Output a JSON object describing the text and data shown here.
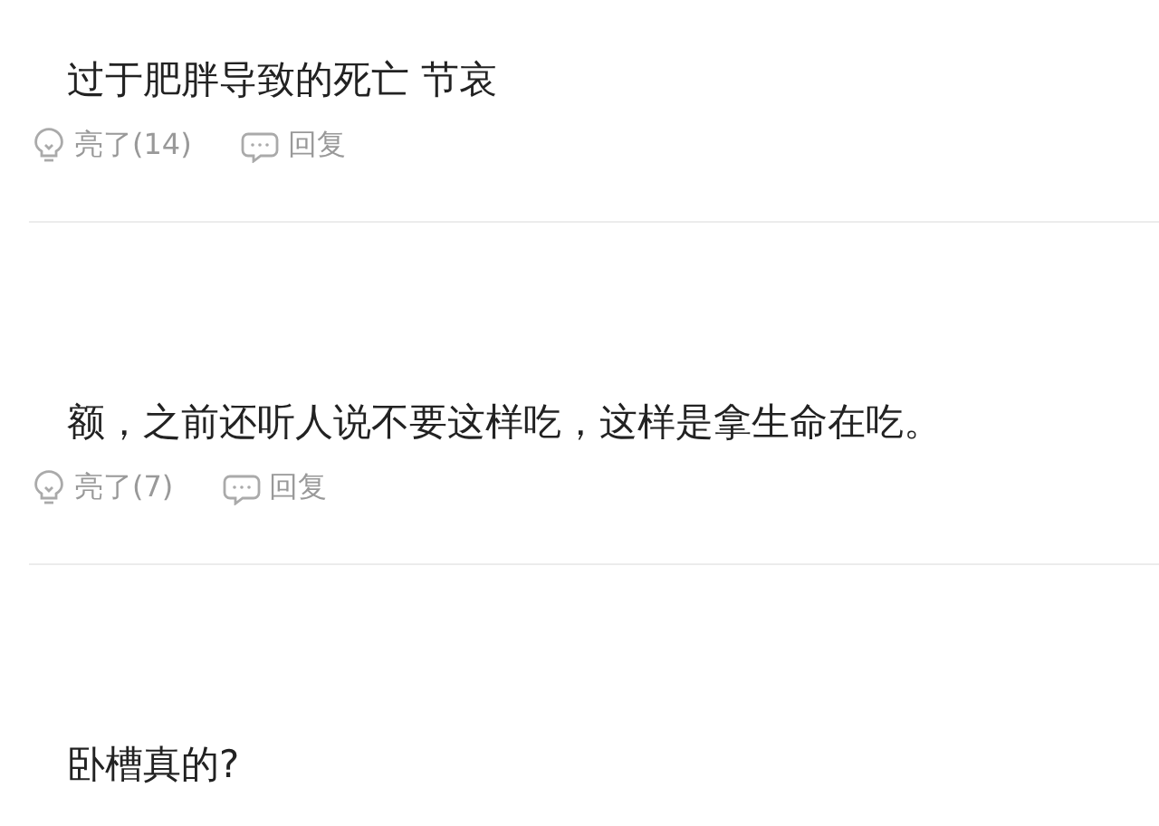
{
  "comments": [
    {
      "text": "过于肥胖导致的死亡 节哀",
      "like": "亮了(14)",
      "reply": "回复"
    },
    {
      "text": "额，之前还听人说不要这样吃，这样是拿生命在吃。",
      "like": "亮了(7)",
      "reply": "回复"
    },
    {
      "text": "卧槽真的?"
    }
  ]
}
